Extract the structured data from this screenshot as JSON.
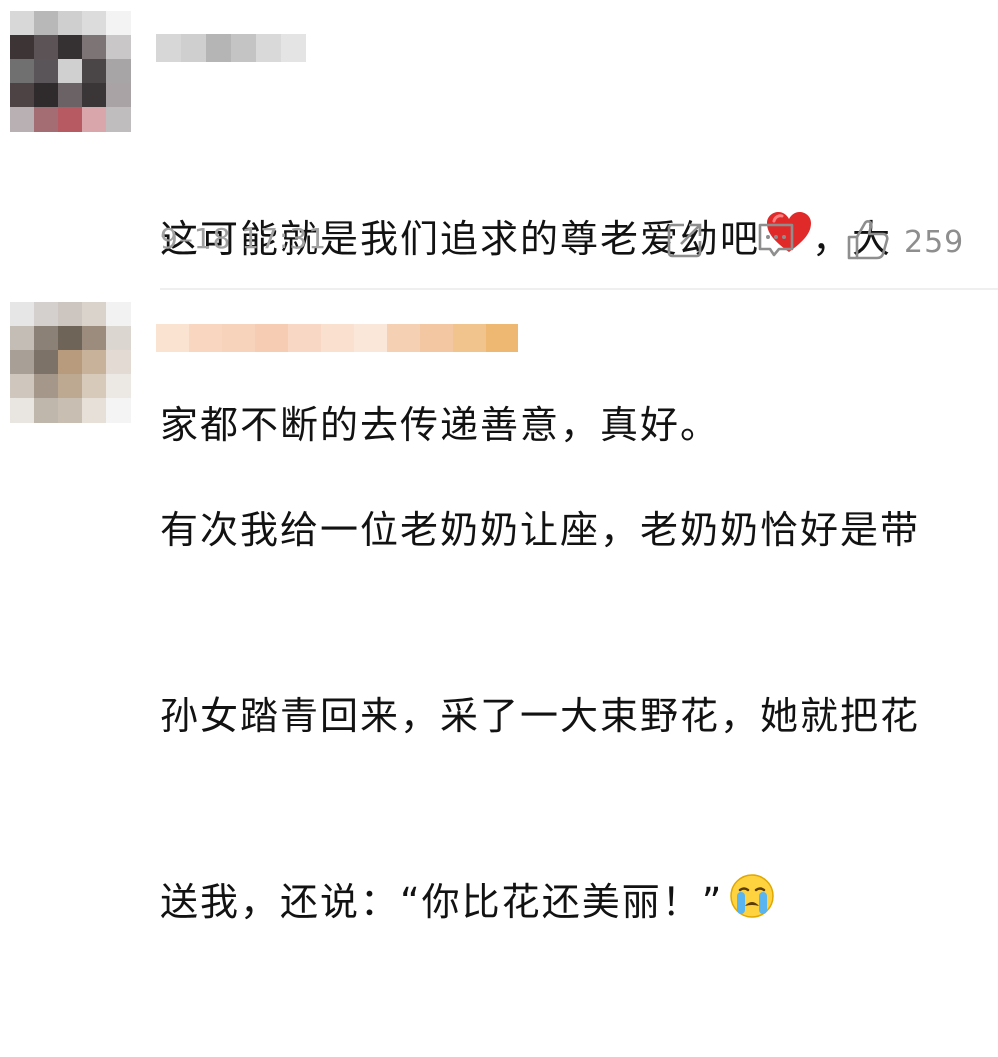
{
  "comments": [
    {
      "avatar_colors": [
        "#d8d8d8",
        "#b8b8b8",
        "#cfcfcf",
        "#dcdcdc",
        "#f3f3f3",
        "#3d3436",
        "#5b5356",
        "#353031",
        "#7d7476",
        "#c9c7c8",
        "#707070",
        "#5a5558",
        "#d0d0d0",
        "#4a4547",
        "#a8a5a6",
        "#4d4244",
        "#2f2b2c",
        "#6a6264",
        "#3a3537",
        "#a9a3a5",
        "#b8b0b2",
        "#a46d73",
        "#b85a62",
        "#d9a7ab",
        "#c0bdbe"
      ],
      "username_colors": [
        "#d7d7d7",
        "#cfcfcf",
        "#b5b5b5",
        "#c4c4c4",
        "#d9d9d9",
        "#e4e4e4"
      ],
      "text_lines": [
        "这可能就是我们追求的尊老爱幼吧",
        "家都不断的去传递善意，真好。"
      ],
      "text_tail": "，大",
      "time": "9–18 17:31",
      "like_count": "259"
    },
    {
      "avatar_colors": [
        "#e6e6e6",
        "#d4d0cd",
        "#cdc6c0",
        "#d9d3cc",
        "#f2f2f2",
        "#c4bdb6",
        "#8c8176",
        "#6f6458",
        "#9b8c7e",
        "#dcd6d0",
        "#a89f96",
        "#7d7268",
        "#b89b7d",
        "#c8b29a",
        "#e3dbd3",
        "#cfc6bd",
        "#a5978a",
        "#bda891",
        "#d8cabb",
        "#ece8e3",
        "#e9e6e2",
        "#bfb6ac",
        "#c9beb2",
        "#e7e0d8",
        "#f4f4f4"
      ],
      "username_colors": [
        "#fbe3d2",
        "#f9d6c0",
        "#f7d3bc",
        "#f6cdb3",
        "#f8d8c4",
        "#fae0cf",
        "#fbe7da",
        "#f6d0b3",
        "#f3c7a2",
        "#f1c48d",
        "#efb872"
      ],
      "text_lines": [
        "有次我给一位老奶奶让座，老奶奶恰好是带",
        "孙女踏青回来，采了一大束野花，她就把花",
        "送我，还说：“你比花还美丽！”"
      ]
    }
  ]
}
